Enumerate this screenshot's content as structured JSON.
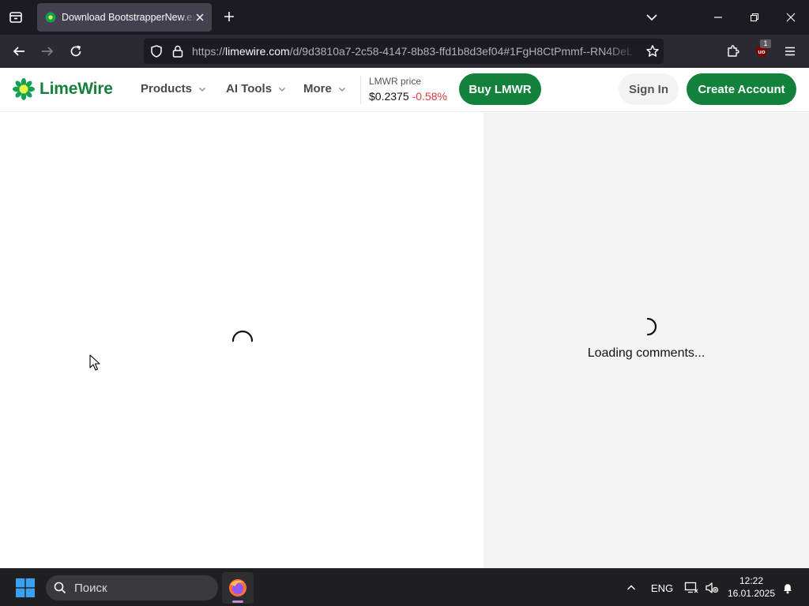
{
  "browser": {
    "tab": {
      "title": "Download BootstrapperNew.exe | LimeWire"
    },
    "url": {
      "prefix": "https://",
      "host": "limewire.com",
      "path": "/d/9d3810a7-2c58-4147-8b83-ffd1b8d3ef04#1FgH8CtPmmf--RN4DeL"
    },
    "extension_badge": "1"
  },
  "site": {
    "logo_text": "LimeWire",
    "nav": [
      {
        "label": "Products"
      },
      {
        "label": "AI Tools"
      },
      {
        "label": "More"
      }
    ],
    "price": {
      "label": "LMWR price",
      "value": "$0.2375",
      "change": "-0.58%"
    },
    "buy_button": "Buy LMWR",
    "signin_button": "Sign In",
    "create_button": "Create Account",
    "brand_color": "#11813c"
  },
  "content": {
    "comments_loading": "Loading comments..."
  },
  "taskbar": {
    "search_placeholder": "Поиск",
    "language": "ENG",
    "time": "12:22",
    "date": "16.01.2025"
  }
}
